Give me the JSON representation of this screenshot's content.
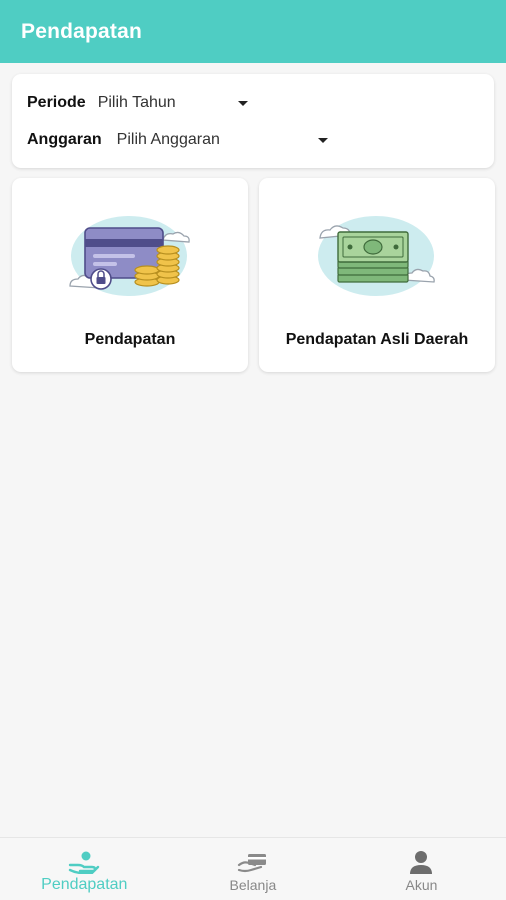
{
  "appbar": {
    "title": "Pendapatan"
  },
  "filters": {
    "periode": {
      "label": "Periode",
      "value": "Pilih Tahun"
    },
    "anggaran": {
      "label": "Anggaran",
      "value": "Pilih Anggaran"
    }
  },
  "menu": [
    {
      "label": "Pendapatan",
      "icon": "credit-card-coins-icon"
    },
    {
      "label": "Pendapatan Asli Daerah",
      "icon": "cash-stack-icon"
    }
  ],
  "bottom_nav": {
    "active": "Pendapatan",
    "items": [
      {
        "label": "Pendapatan",
        "icon": "hand-money-icon"
      },
      {
        "label": "Belanja",
        "icon": "card-payment-icon"
      },
      {
        "label": "Akun",
        "icon": "user-icon"
      }
    ]
  },
  "colors": {
    "accent": "#4fcdc3",
    "background": "#f6f6f6"
  }
}
